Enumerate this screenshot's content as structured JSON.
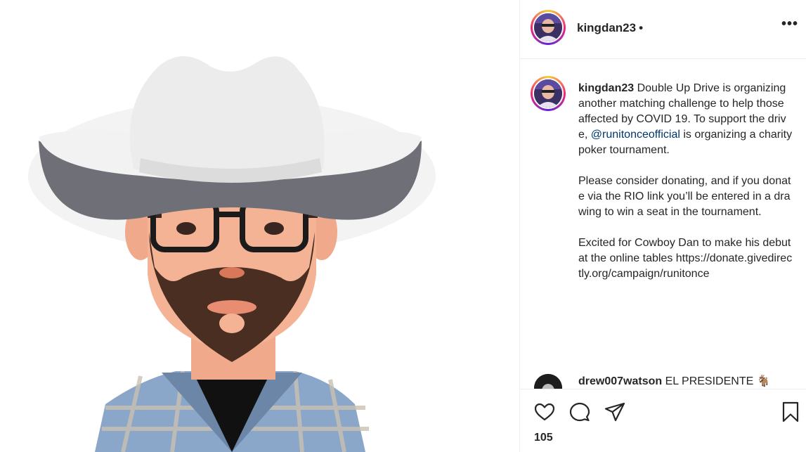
{
  "post": {
    "username": "kingdan23",
    "separator": "•",
    "more_label": "•••",
    "caption": {
      "username": "kingdan23",
      "text_before_mention": " Double Up Drive is organizing another matching challenge to help those affected by COVID 19. To support the drive, ",
      "mention": "@runitonceofficial",
      "text_after_mention": " is organizing a charity poker tournament.\n\nPlease consider donating, and if you donate via the RIO link you’ll be entered in a drawing to win a seat in the tournament.\n\nExcited for Cowboy Dan to make his debut at the online tables https://donate.givedirectly.org/campaign/runitonce"
    },
    "comment": {
      "username": "drew007watson",
      "text": " EL PRESIDENTE 🐐"
    },
    "likes": "105"
  },
  "icons": {
    "like": "heart-icon",
    "comment": "comment-bubble-icon",
    "share": "paper-plane-icon",
    "save": "bookmark-icon",
    "more": "more-dots-icon"
  },
  "colors": {
    "mention": "#00376b",
    "text": "#262626",
    "divider": "#efefef"
  }
}
